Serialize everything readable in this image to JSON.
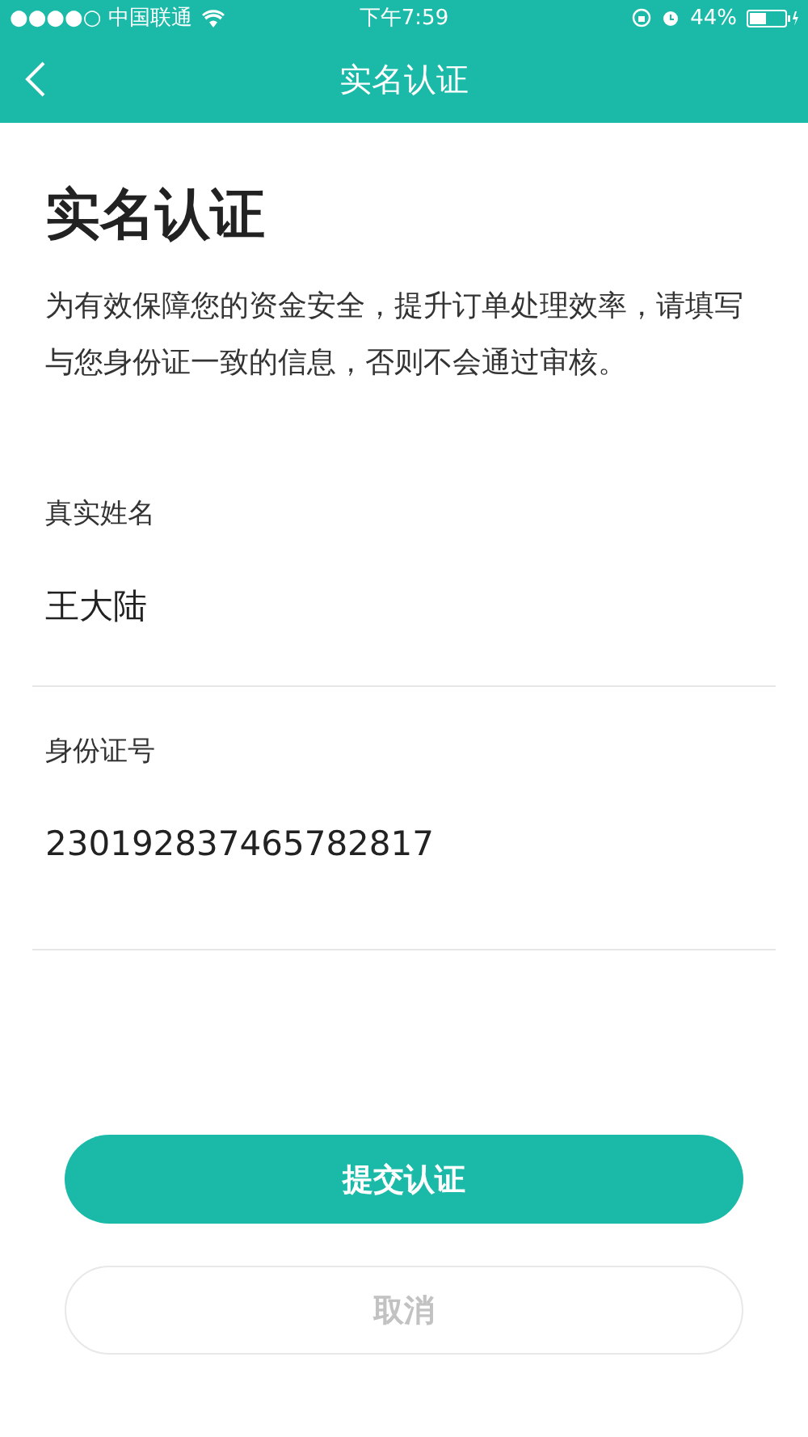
{
  "status_bar": {
    "carrier": "●●●●○ 中国联通",
    "time": "下午7:59",
    "battery": "44%"
  },
  "nav_bar": {
    "title": "实名认证"
  },
  "heading": "实名认证",
  "description": "为有效保障您的资金安全，提升订单处理效率，请填写与您身份证一致的信息，否则不会通过审核。",
  "fields": [
    {
      "label": "真实姓名",
      "value": "王大陆"
    },
    {
      "label": "身份证号",
      "value": "230192837465782817"
    }
  ],
  "buttons": [
    {
      "label": "提交认证",
      "kind": "primary"
    },
    {
      "label": "取消",
      "kind": "secondary"
    }
  ]
}
